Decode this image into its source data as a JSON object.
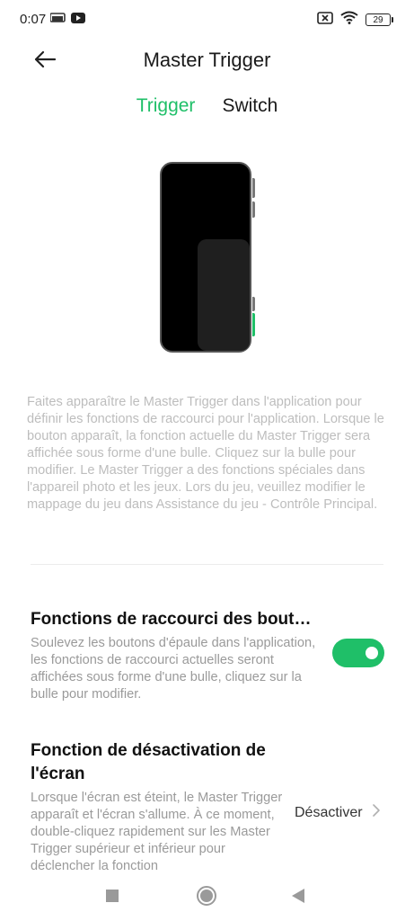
{
  "status_bar": {
    "time": "0:07",
    "left_icons": [
      "cast-icon",
      "youtube-icon"
    ],
    "right_icons": [
      "no-sim-icon",
      "wifi-icon",
      "battery-icon"
    ],
    "battery_level": "29"
  },
  "header": {
    "back_icon": "arrow-left-icon",
    "title": "Master Trigger"
  },
  "tabs": [
    {
      "label": "Trigger",
      "active": true
    },
    {
      "label": "Switch",
      "active": false
    }
  ],
  "description": "Faites apparaître le Master Trigger dans l'application pour définir les fonctions de raccourci pour l'application. Lorsque le bouton apparaît, la fonction actuelle du Master Trigger sera affichée sous forme d'une bulle. Cliquez sur la bulle pour modifier. Le Master Trigger a des fonctions spéciales dans l'appareil photo et les jeux. Lors du jeu, veuillez modifier le mappage du jeu dans Assistance du jeu - Contrôle Principal.",
  "settings": [
    {
      "title": "Fonctions de raccourci des bout…",
      "description": "Soulevez les boutons d'épaule dans l'application, les fonctions de raccourci actuelles seront affichées sous forme d'une bulle, cliquez sur la bulle pour modifier.",
      "toggle_on": true
    },
    {
      "title": "Fonction de désactivation de l'écran",
      "description": "Lorsque l'écran est éteint, le Master Trigger apparaît et l'écran s'allume. À ce moment, double-cliquez rapidement sur les Master Trigger supérieur et inférieur pour déclencher la fonction",
      "value": "Désactiver"
    }
  ],
  "nav_bar": [
    "recents-square-icon",
    "home-circle-icon",
    "back-triangle-icon"
  ],
  "colors": {
    "accent": "#1fbf68",
    "text_primary": "#1a1a1a",
    "text_secondary": "#9a9a9a",
    "text_hint": "#bdbdbd"
  }
}
